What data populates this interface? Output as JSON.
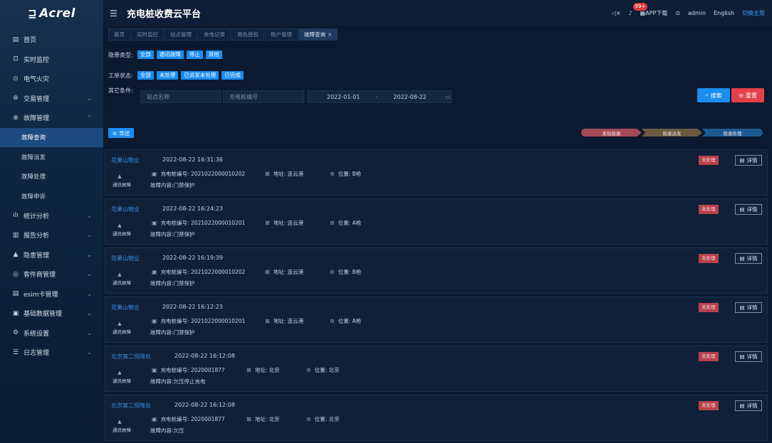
{
  "app": {
    "logo": "Acrel",
    "title": "充电桩收费云平台"
  },
  "header": {
    "app_download": "APP下载",
    "badge": "99+",
    "user": "admin",
    "language": "English",
    "switch_theme": "切换主题"
  },
  "sidebar": {
    "items": [
      {
        "icon": "home-icon",
        "glyph": "▤",
        "label": "首页"
      },
      {
        "icon": "monitor-icon",
        "glyph": "⊡",
        "label": "实时监控"
      },
      {
        "icon": "fire-icon",
        "glyph": "⊙",
        "label": "电气火灾"
      },
      {
        "icon": "transaction-icon",
        "glyph": "⊛",
        "label": "交易管理",
        "chevron": "⌄"
      },
      {
        "icon": "fault-icon",
        "glyph": "⊗",
        "label": "故障管理",
        "chevron": "⌃"
      },
      {
        "label": "故障查询",
        "sub": true,
        "active": true
      },
      {
        "label": "故障派发",
        "sub": true
      },
      {
        "label": "故障处理",
        "sub": true
      },
      {
        "label": "故障申诉",
        "sub": true
      },
      {
        "icon": "stats-icon",
        "glyph": "ılı",
        "label": "统计分析",
        "chevron": "⌄"
      },
      {
        "icon": "report-icon",
        "glyph": "▥",
        "label": "报告分析",
        "chevron": "⌄"
      },
      {
        "icon": "hazard-icon",
        "glyph": "▲",
        "label": "隐患管理",
        "chevron": "⌄"
      },
      {
        "icon": "agent-icon",
        "glyph": "◎",
        "label": "客件商管理",
        "chevron": "⌄"
      },
      {
        "icon": "sim-icon",
        "glyph": "▤",
        "label": "esim卡管理",
        "chevron": "⌄"
      },
      {
        "icon": "database-icon",
        "glyph": "▣",
        "label": "基础数据管理",
        "chevron": "⌄"
      },
      {
        "icon": "settings-icon",
        "glyph": "⚙",
        "label": "系统设置",
        "chevron": "⌄"
      },
      {
        "icon": "log-icon",
        "glyph": "☰",
        "label": "日志管理",
        "chevron": "⌄"
      }
    ]
  },
  "tabs": [
    {
      "label": "首页"
    },
    {
      "label": "实时监控"
    },
    {
      "label": "站点管理"
    },
    {
      "label": "充电记录"
    },
    {
      "label": "角色授权"
    },
    {
      "label": "账户管理"
    },
    {
      "label": "故障查询",
      "active": true
    }
  ],
  "filters": {
    "hazard_type_label": "隐患类型:",
    "hazard_types": [
      "全部",
      "通讯故障",
      "停止",
      "其他"
    ],
    "order_status_label": "工单状态:",
    "order_statuses": [
      "全部",
      "未处理",
      "已派发未处理",
      "已完成"
    ],
    "other_label": "其它条件:",
    "site_placeholder": "站点名称",
    "pile_placeholder": "充电桩编号",
    "date_start": "2022-01-01",
    "date_sep": "-",
    "date_end": "2022-08-22",
    "search": "搜索",
    "reset": "重置"
  },
  "export_label": "导出",
  "steps": [
    {
      "label": "发现隐患",
      "color": "#a54a55"
    },
    {
      "label": "隐患派发",
      "color": "#6b5a42"
    },
    {
      "label": "隐患处理",
      "color": "#1e5a92"
    }
  ],
  "records": [
    {
      "site": "花果山物业",
      "time": "2022-08-22 16:31:36",
      "fault_type": "通讯故障",
      "pile": "充电桩编号: 2021022000010202",
      "address": "地址: 连云港",
      "position": "位置: B枪",
      "content": "故障内容:门禁保护",
      "status": "未处理",
      "detail": "详情"
    },
    {
      "site": "花果山物业",
      "time": "2022-08-22 16:24:23",
      "fault_type": "通讯故障",
      "pile": "充电桩编号: 2021022000010201",
      "address": "地址: 连云港",
      "position": "位置: A枪",
      "content": "故障内容:门禁保护",
      "status": "未处理",
      "detail": "详情"
    },
    {
      "site": "花果山物业",
      "time": "2022-08-22 16:19:39",
      "fault_type": "通讯故障",
      "pile": "充电桩编号: 2021022000010202",
      "address": "地址: 连云港",
      "position": "位置: B枪",
      "content": "故障内容:门禁保护",
      "status": "未处理",
      "detail": "详情"
    },
    {
      "site": "花果山物业",
      "time": "2022-08-22 16:12:23",
      "fault_type": "通讯故障",
      "pile": "充电桩编号: 2021022000010201",
      "address": "地址: 连云港",
      "position": "位置: A枪",
      "content": "故障内容:门禁保护",
      "status": "未处理",
      "detail": "详情"
    },
    {
      "site": "北京第二保障处",
      "time": "2022-08-22 16:12:08",
      "fault_type": "通讯故障",
      "pile": "充电桩编号: 2020001877",
      "address": "地址: 北京",
      "position": "位置: 北京",
      "content": "故障内容:欠压停止充电",
      "status": "未处理",
      "detail": "详情"
    },
    {
      "site": "北京第二保障处",
      "time": "2022-08-22 16:12:08",
      "fault_type": "通讯故障",
      "pile": "充电桩编号: 2020001877",
      "address": "地址: 北京",
      "position": "位置: 北京",
      "content": "故障内容:欠压",
      "status": "未处理",
      "detail": "详情"
    }
  ]
}
